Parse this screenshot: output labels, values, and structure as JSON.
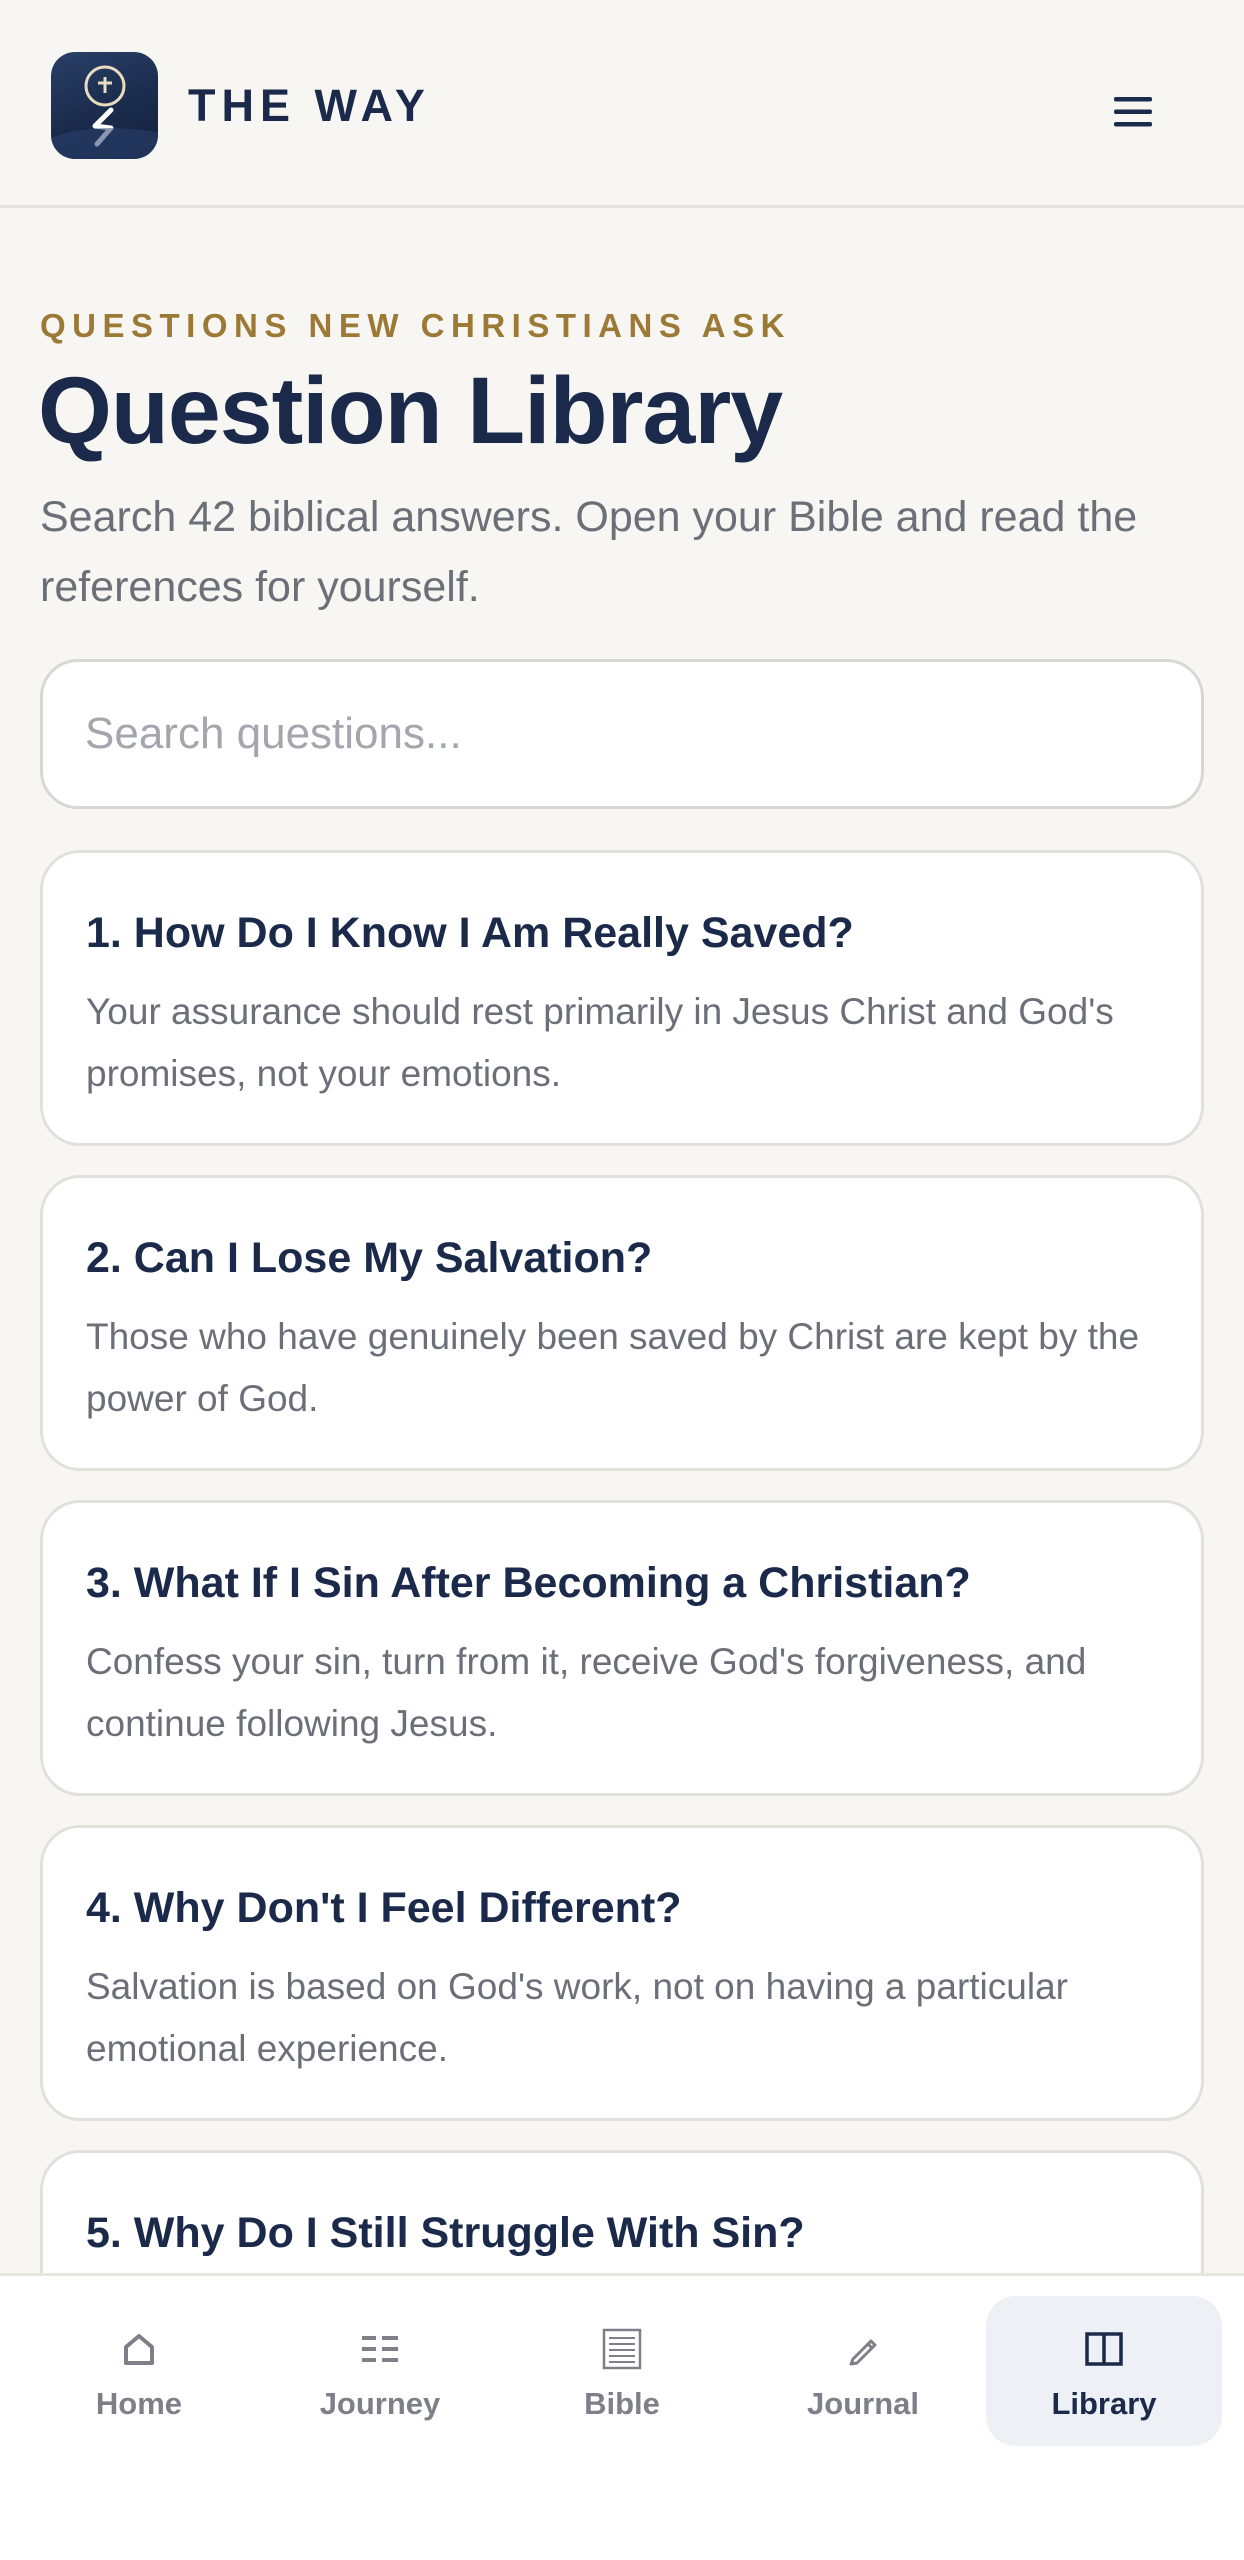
{
  "header": {
    "brand": "THE WAY",
    "menu_icon": "hamburger-menu-icon"
  },
  "hero": {
    "eyebrow": "QUESTIONS NEW CHRISTIANS ASK",
    "title": "Question Library",
    "subtitle": "Search 42 biblical answers. Open your Bible and read the references for yourself."
  },
  "search": {
    "placeholder": "Search questions...",
    "value": ""
  },
  "questions": [
    {
      "title": "1. How Do I Know I Am Really Saved?",
      "summary": "Your assurance should rest primarily in Jesus Christ and God's promises, not your emotions."
    },
    {
      "title": "2. Can I Lose My Salvation?",
      "summary": "Those who have genuinely been saved by Christ are kept by the power of God."
    },
    {
      "title": "3. What If I Sin After Becoming a Christian?",
      "summary": "Confess your sin, turn from it, receive God's forgiveness, and continue following Jesus."
    },
    {
      "title": "4. Why Don't I Feel Different?",
      "summary": "Salvation is based on God's work, not on having a particular emotional experience."
    },
    {
      "title": "5. Why Do I Still Struggle With Sin?",
      "summary": ""
    }
  ],
  "nav": {
    "active": "library",
    "items": [
      {
        "id": "home",
        "label": "Home",
        "icon": "home-icon"
      },
      {
        "id": "journey",
        "label": "Journey",
        "icon": "journey-list-icon"
      },
      {
        "id": "bible",
        "label": "Bible",
        "icon": "bible-page-icon"
      },
      {
        "id": "journal",
        "label": "Journal",
        "icon": "pencil-icon"
      },
      {
        "id": "library",
        "label": "Library",
        "icon": "library-book-icon"
      }
    ]
  },
  "colors": {
    "navy": "#1b2a4a",
    "gold": "#9c7a35",
    "muted_text": "#6b6f78",
    "background": "#f7f6f3"
  }
}
